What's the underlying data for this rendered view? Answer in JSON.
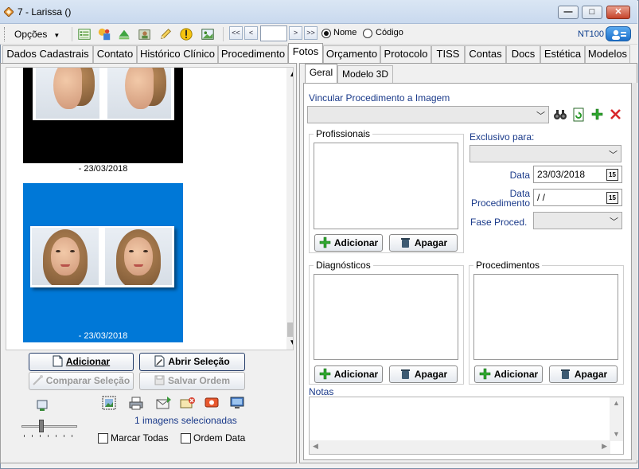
{
  "window": {
    "title": "7 - Larissa ()",
    "minimize_label": "—",
    "maximize_label": "□",
    "close_label": "✕"
  },
  "toolbar": {
    "options_label": "Opções",
    "nav_first": "<<",
    "nav_prev": "<",
    "nav_next": ">",
    "nav_last": ">>",
    "nav_value": "",
    "radio_name": "Nome",
    "radio_code": "Código",
    "selected_radio": "Nome",
    "version": "NT100"
  },
  "tabs": [
    {
      "label": "Dados Cadastrais"
    },
    {
      "label": "Contato"
    },
    {
      "label": "Histórico Clínico"
    },
    {
      "label": "Procedimento"
    },
    {
      "label": "Fotos"
    },
    {
      "label": "Orçamento"
    },
    {
      "label": "Protocolo"
    },
    {
      "label": "TISS"
    },
    {
      "label": "Contas"
    },
    {
      "label": "Docs"
    },
    {
      "label": "Estética"
    },
    {
      "label": "Modelos"
    }
  ],
  "active_tab": "Fotos",
  "gallery": {
    "items": [
      {
        "date": "- 23/03/2018",
        "selected": false
      },
      {
        "date": "- 23/03/2018",
        "selected": true
      }
    ]
  },
  "left_actions": {
    "add": "Adicionar",
    "open_selection": "Abrir Seleção",
    "compare_selection": "Comparar Seleção",
    "save_order": "Salvar Ordem",
    "selected_count": "1 imagens selecionadas",
    "mark_all": "Marcar Todas",
    "order_date": "Ordem Data"
  },
  "inner_tabs": [
    {
      "label": "Geral"
    },
    {
      "label": "Modelo 3D"
    }
  ],
  "general": {
    "link_label": "Vincular Procedimento a Imagem",
    "professionals_title": "Profissionais",
    "exclusive_label": "Exclusivo para:",
    "date_label": "Data",
    "date_value": "23/03/2018",
    "procedure_date_label_1": "Data",
    "procedure_date_label_2": "Procedimento",
    "procedure_date_value": " /  /",
    "phase_label": "Fase Proced.",
    "diagnostics_title": "Diagnósticos",
    "procedures_title": "Procedimentos",
    "add_label": "Adicionar",
    "delete_label": "Apagar",
    "notes_label": "Notas"
  },
  "colors": {
    "accent_blue": "#0078d7",
    "label_blue": "#1a3a8a"
  }
}
